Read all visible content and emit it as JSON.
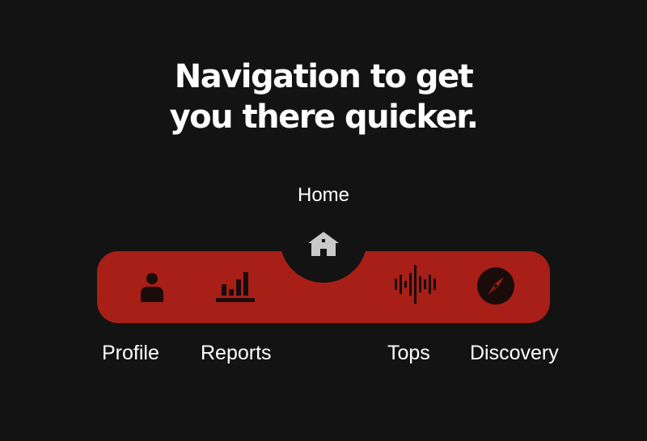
{
  "headline": {
    "line1": "Navigation to get",
    "line2": "you there quicker."
  },
  "nav": {
    "active": {
      "label": "Home",
      "icon": "house-icon"
    },
    "items": [
      {
        "label": "Profile",
        "icon": "person-icon"
      },
      {
        "label": "Reports",
        "icon": "bar-chart-icon"
      },
      {
        "label": "Tops",
        "icon": "sound-wave-icon"
      },
      {
        "label": "Discovery",
        "icon": "compass-icon"
      }
    ]
  },
  "colors": {
    "background": "#131313",
    "bar": "#a71f17",
    "text": "#ffffff",
    "icon_dark": "#1a0c0b",
    "home_icon": "#c9c9c9"
  }
}
